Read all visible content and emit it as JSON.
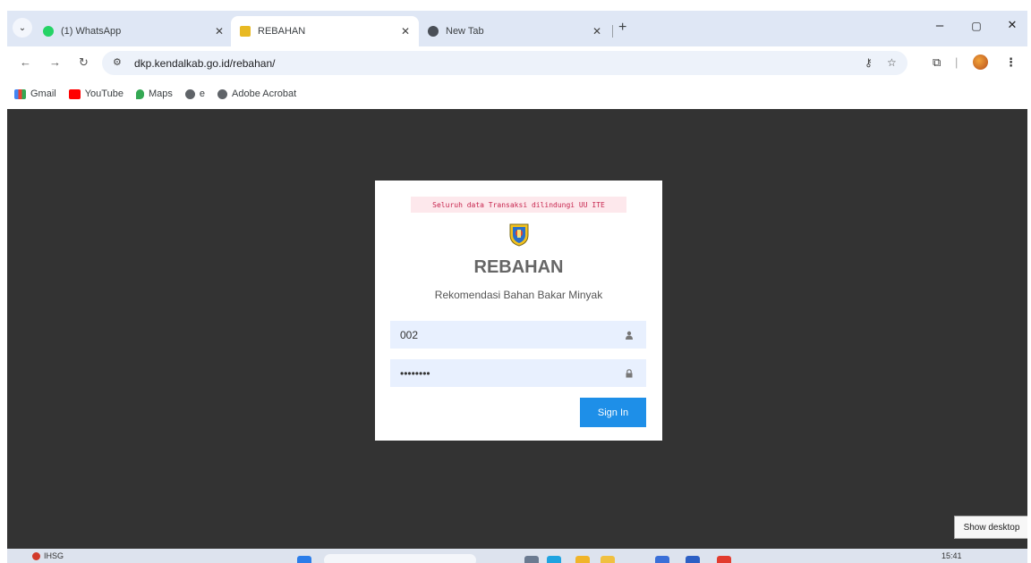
{
  "browser": {
    "tabs": [
      {
        "title": "(1) WhatsApp",
        "favicon": "whatsapp-icon",
        "active": false
      },
      {
        "title": "REBAHAN",
        "favicon": "emblem-icon",
        "active": true
      },
      {
        "title": "New Tab",
        "favicon": "chrome-icon",
        "active": false
      }
    ],
    "new_tab_glyph": "+",
    "window_controls": {
      "minimize": "–",
      "maximize": "▢",
      "close": "✕"
    },
    "url": "dkp.kendalkab.go.id/rebahan/",
    "bookmarks": [
      {
        "label": "Gmail",
        "icon": "gmail-icon"
      },
      {
        "label": "YouTube",
        "icon": "youtube-icon"
      },
      {
        "label": "Maps",
        "icon": "maps-icon"
      },
      {
        "label": "e",
        "icon": "globe-icon"
      },
      {
        "label": "Adobe Acrobat",
        "icon": "globe-icon"
      }
    ]
  },
  "login": {
    "notice": "Seluruh data Transaksi dilindungi UU ITE",
    "title": "REBAHAN",
    "subtitle": "Rekomendasi Bahan Bakar Minyak",
    "username_value": "002",
    "password_value": "••••••••",
    "signin_label": "Sign In"
  },
  "tooltip": {
    "show_desktop": "Show desktop"
  },
  "taskbar": {
    "widget_label": "IHSG",
    "clock": "15:41"
  },
  "colors": {
    "page_background": "#333333",
    "notice_text": "#c7254e",
    "notice_background": "#fde8ec",
    "signin_button": "#1e8fe8",
    "input_background": "#e8f0fe"
  }
}
